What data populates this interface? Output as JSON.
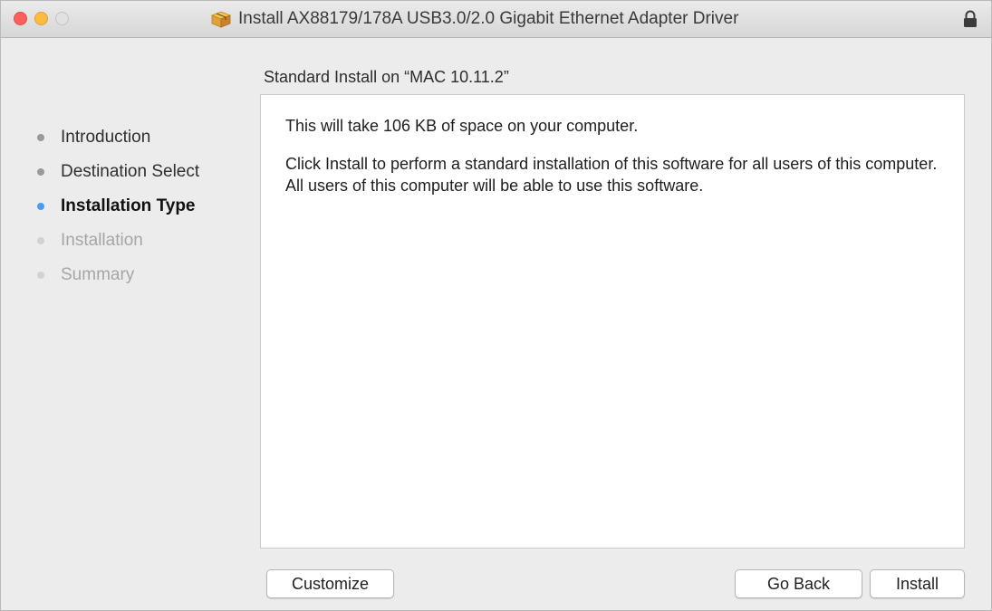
{
  "window": {
    "title": "Install AX88179/178A USB3.0/2.0 Gigabit Ethernet Adapter Driver",
    "title_icon": "package-icon",
    "lock_icon": "lock-icon"
  },
  "sidebar": {
    "steps": [
      {
        "label": "Introduction",
        "state": "completed"
      },
      {
        "label": "Destination Select",
        "state": "completed"
      },
      {
        "label": "Installation Type",
        "state": "current"
      },
      {
        "label": "Installation",
        "state": "pending"
      },
      {
        "label": "Summary",
        "state": "pending"
      }
    ]
  },
  "main": {
    "heading": "Standard Install on “MAC 10.11.2”",
    "paragraphs": [
      "This will take 106 KB of space on your computer.",
      "Click Install to perform a standard installation of this software for all users of this computer. All users of this computer will be able to use this software."
    ]
  },
  "buttons": {
    "customize": "Customize",
    "go_back": "Go Back",
    "install": "Install"
  },
  "colors": {
    "current_step_dot": "#4a9bf2",
    "close": "#fc605c",
    "minimize": "#fdbc40"
  }
}
